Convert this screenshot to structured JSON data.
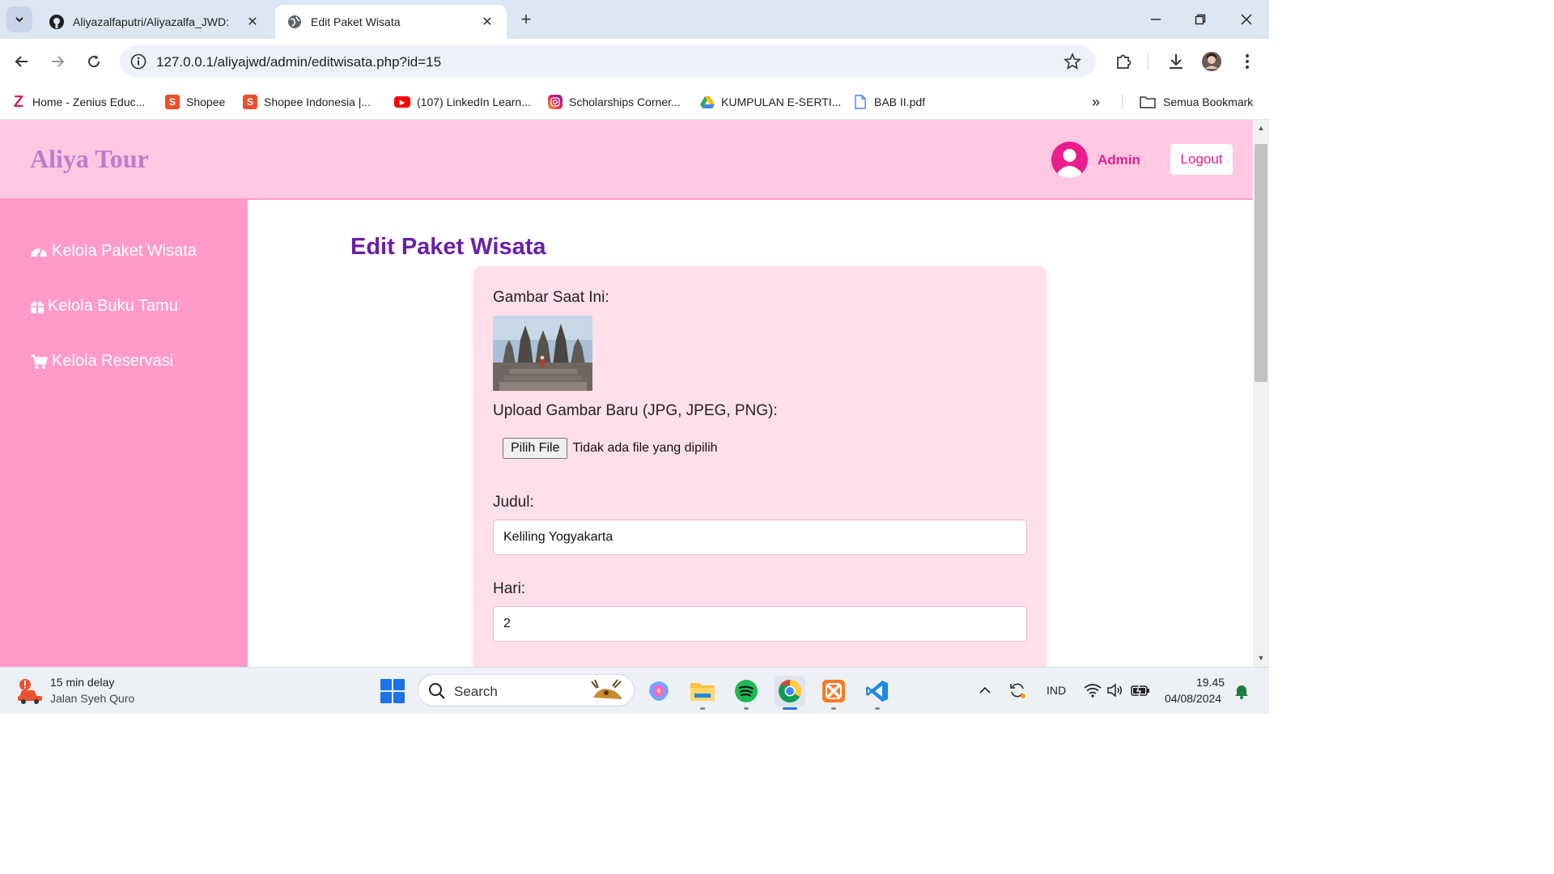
{
  "browser": {
    "tabs": [
      {
        "title": "Aliyazalfaputri/Aliyazalfa_JWD: ",
        "icon": "github-icon",
        "active": false
      },
      {
        "title": "Edit Paket Wisata",
        "icon": "globe-icon",
        "active": true
      }
    ],
    "url": "127.0.0.1/aliyajwd/admin/editwisata.php?id=15",
    "bookmarks": [
      {
        "label": "Home - Zenius Educ...",
        "icon": "zenius-icon"
      },
      {
        "label": "Shopee",
        "icon": "shopee-icon"
      },
      {
        "label": "Shopee Indonesia |...",
        "icon": "shopee-icon"
      },
      {
        "label": "(107) LinkedIn Learn...",
        "icon": "youtube-icon"
      },
      {
        "label": "Scholarships Corner...",
        "icon": "instagram-icon"
      },
      {
        "label": "KUMPULAN E-SERTI...",
        "icon": "google-drive-icon"
      },
      {
        "label": "BAB II.pdf",
        "icon": "file-icon"
      }
    ],
    "all_bookmarks_label": "Semua Bookmark"
  },
  "header": {
    "brand": "Aliya Tour",
    "admin_label": "Admin",
    "logout_label": "Logout"
  },
  "sidebar": {
    "items": [
      {
        "label": "Kelola Paket Wisata",
        "icon": "dashboard-icon"
      },
      {
        "label": "Kelola Buku Tamu",
        "icon": "gift-icon"
      },
      {
        "label": "Kelola Reservasi",
        "icon": "cart-icon"
      }
    ]
  },
  "main": {
    "title": "Edit Paket Wisata",
    "form": {
      "current_image_label": "Gambar Saat Ini:",
      "upload_label": "Upload Gambar Baru (JPG, JPEG, PNG):",
      "file_button": "Pilih File",
      "file_status": "Tidak ada file yang dipilih",
      "judul_label": "Judul:",
      "judul_value": "Keliling Yogyakarta",
      "hari_label": "Hari:",
      "hari_value": "2"
    }
  },
  "taskbar": {
    "weather_line1": "15 min delay",
    "weather_line2": "Jalan Syeh Quro",
    "search_placeholder": "Search",
    "language": "IND",
    "time": "19.45",
    "date": "04/08/2024"
  },
  "colors": {
    "header_bg": "#ffc8e2",
    "sidebar_bg": "#ff9acb",
    "accent_pink": "#e91e8c",
    "title_purple": "#6a1fa8",
    "card_bg": "#ffe0ea"
  }
}
